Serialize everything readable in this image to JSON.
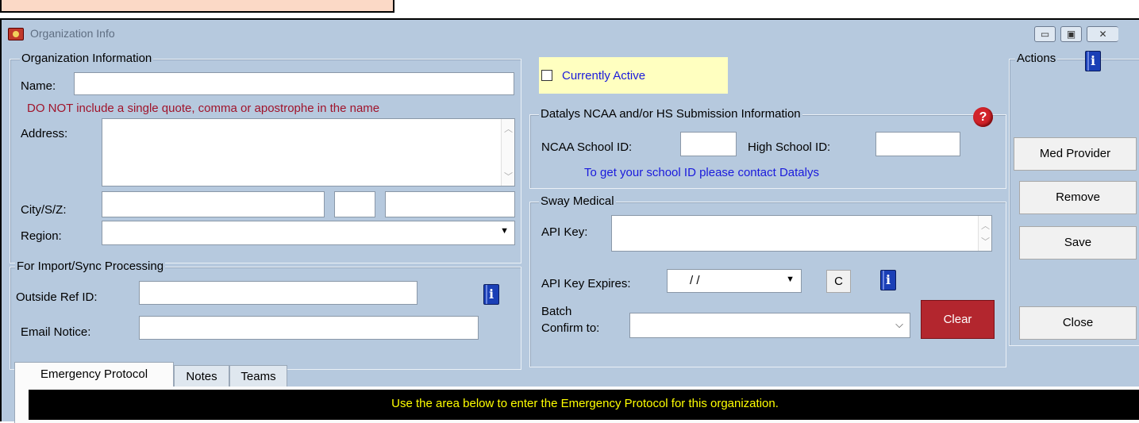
{
  "window": {
    "title": "Organization Info",
    "minimize": "▭",
    "maximize": "▣",
    "close": "✕"
  },
  "org_info": {
    "group_label": "Organization Information",
    "name_label": "Name:",
    "name_value": "",
    "warning": "DO NOT include a single quote, comma or apostrophe in the name",
    "address_label": "Address:",
    "address_value": "",
    "city_label": "City/S/Z:",
    "city_value": "",
    "state_value": "",
    "zip_value": "",
    "region_label": "Region:",
    "region_value": ""
  },
  "import_sync": {
    "group_label": "For Import/Sync Processing",
    "outside_ref_label": "Outside Ref ID:",
    "outside_ref_value": "",
    "email_notice_label": "Email Notice:",
    "email_notice_value": ""
  },
  "active": {
    "label": "Currently Active",
    "checked": false
  },
  "datalys": {
    "group_label": "Datalys NCAA and/or HS Submission Information",
    "ncaa_label": "NCAA School ID:",
    "ncaa_value": "",
    "hs_label": "High School ID:",
    "hs_value": "",
    "contact_note": "To get your school ID please contact Datalys",
    "help_icon": "?"
  },
  "sway": {
    "group_label": "Sway Medical",
    "api_key_label": "API Key:",
    "api_key_value": "",
    "expires_label": "API Key Expires:",
    "expires_value": "  /   /",
    "calendar_btn": "C",
    "batch_label_1": "Batch",
    "batch_label_2": "Confirm to:",
    "batch_value": "",
    "clear_btn": "Clear"
  },
  "actions": {
    "group_label": "Actions",
    "med_provider": "Med Provider",
    "remove": "Remove",
    "save": "Save",
    "close": "Close"
  },
  "info_icon_glyph": "i",
  "tabs": [
    {
      "label": "Emergency Protocol",
      "active": true
    },
    {
      "label": "Notes",
      "active": false
    },
    {
      "label": "Teams",
      "active": false
    }
  ],
  "protocol_banner": "Use the area below to enter the Emergency Protocol for this organization.",
  "colors": {
    "window_bg": "#b6c9de",
    "warning": "#a0142b",
    "link_blue": "#1a1adc",
    "clear_red": "#b3262e",
    "banner_text": "#ffff00"
  }
}
